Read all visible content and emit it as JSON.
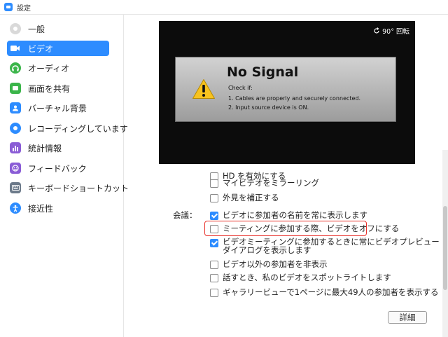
{
  "window": {
    "title": "設定"
  },
  "sidebar": {
    "items": [
      {
        "label": "一般",
        "icon": "gear-icon",
        "color": "#cfcfcf"
      },
      {
        "label": "ビデオ",
        "icon": "video-camera-icon",
        "color": "#2d8cff",
        "active": true
      },
      {
        "label": "オーディオ",
        "icon": "headphones-icon",
        "color": "#3bb54a"
      },
      {
        "label": "画面を共有",
        "icon": "share-screen-icon",
        "color": "#3bb54a"
      },
      {
        "label": "バーチャル背景",
        "icon": "virtual-background-icon",
        "color": "#2d8cff"
      },
      {
        "label": "レコーディングしています",
        "icon": "record-icon",
        "color": "#2d8cff"
      },
      {
        "label": "統計情報",
        "icon": "statistics-icon",
        "color": "#8a5cd6"
      },
      {
        "label": "フィードバック",
        "icon": "feedback-icon",
        "color": "#8a5cd6"
      },
      {
        "label": "キーボードショートカット",
        "icon": "keyboard-icon",
        "color": "#6c7a8a"
      },
      {
        "label": "接近性",
        "icon": "accessibility-icon",
        "color": "#2d8cff"
      }
    ]
  },
  "preview": {
    "rotate_label": "90° 回転",
    "no_signal_title": "No Signal",
    "check_if": "Check if:",
    "line1": "1. Cables are properly and securely connected.",
    "line2": "2. Input source device is ON."
  },
  "video_options": {
    "cut_label": "HD を有効にする",
    "mirror_label": "マイビデオをミラーリング",
    "touch_up_label": "外見を補正する",
    "mirror_checked": false,
    "touch_up_checked": false
  },
  "meeting": {
    "section_label": "会議：",
    "options": [
      {
        "label": "ビデオに参加者の名前を常に表示します",
        "checked": true
      },
      {
        "label": "ミーティングに参加する際、ビデオをオフにする",
        "checked": false
      },
      {
        "label": "ビデオミーティングに参加するときに常にビデオプレビューダイアログを表示します",
        "checked": true
      },
      {
        "label": "ビデオ以外の参加者を非表示",
        "checked": false
      },
      {
        "label": "話すとき、私のビデオをスポットライトします",
        "checked": false
      },
      {
        "label": "ギャラリービューで1ページに最大49人の参加者を表示する",
        "checked": false
      }
    ]
  },
  "buttons": {
    "detail_label": "詳細"
  },
  "colors": {
    "accent": "#2d8cff",
    "highlight": "#e8302a"
  }
}
